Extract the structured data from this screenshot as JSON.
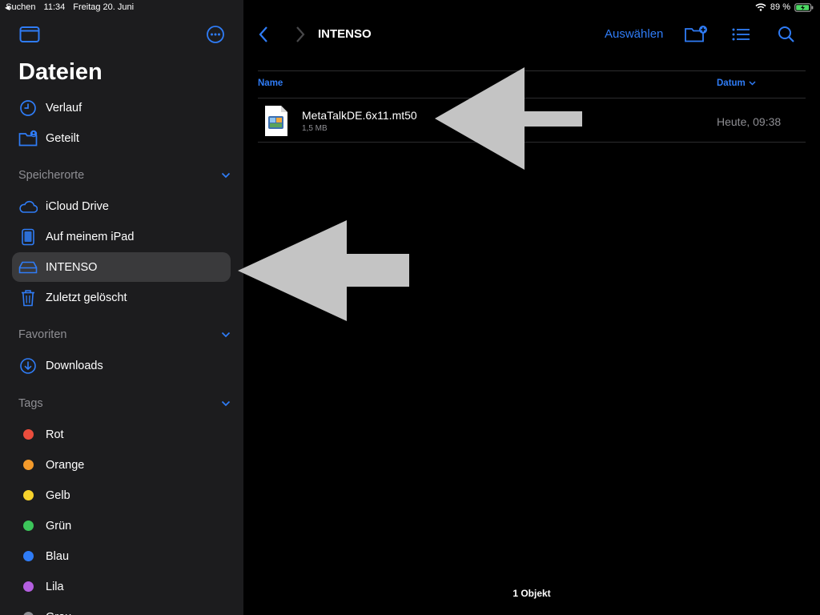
{
  "status_bar": {
    "back_app": "Suchen",
    "time": "11:34",
    "date": "Freitag 20. Juni",
    "battery": "89 %"
  },
  "sidebar": {
    "title": "Dateien",
    "top_items": [
      {
        "label": "Verlauf",
        "icon": "clock-icon"
      },
      {
        "label": "Geteilt",
        "icon": "shared-folder-icon"
      }
    ],
    "locations_header": "Speicherorte",
    "locations": [
      {
        "label": "iCloud Drive",
        "icon": "cloud-icon"
      },
      {
        "label": "Auf meinem iPad",
        "icon": "ipad-icon"
      },
      {
        "label": "INTENSO",
        "icon": "drive-icon",
        "selected": true
      },
      {
        "label": "Zuletzt gelöscht",
        "icon": "trash-icon"
      }
    ],
    "favorites_header": "Favoriten",
    "favorites": [
      {
        "label": "Downloads",
        "icon": "download-icon"
      }
    ],
    "tags_header": "Tags",
    "tags": [
      {
        "label": "Rot",
        "color": "#eb4d3d"
      },
      {
        "label": "Orange",
        "color": "#f39a2b"
      },
      {
        "label": "Gelb",
        "color": "#f7d22c"
      },
      {
        "label": "Grün",
        "color": "#3cc55a"
      },
      {
        "label": "Blau",
        "color": "#2f7cf6"
      },
      {
        "label": "Lila",
        "color": "#b45fe0"
      },
      {
        "label": "Grau",
        "color": "#8e8e93"
      }
    ]
  },
  "toolbar": {
    "title": "INTENSO",
    "select_label": "Auswählen"
  },
  "columns": {
    "name": "Name",
    "date": "Datum"
  },
  "files": [
    {
      "name": "MetaTalkDE.6x11.mt50",
      "size": "1,5 MB",
      "modified": "Heute, 09:38"
    }
  ],
  "footer": {
    "count": "1 Objekt"
  },
  "colors": {
    "accent": "#2f7cf6",
    "sidebar_bg": "#1c1c1e",
    "selected_bg": "#3a3a3c",
    "arrow_fill": "#c4c4c4"
  }
}
